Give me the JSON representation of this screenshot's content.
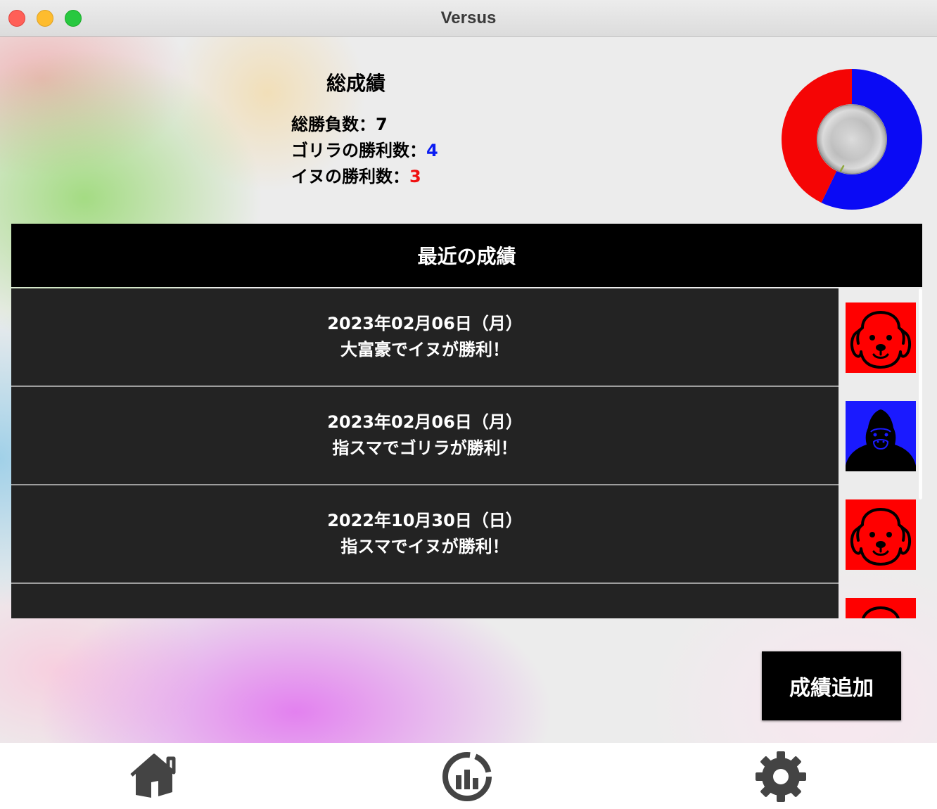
{
  "window": {
    "title": "Versus"
  },
  "summary": {
    "title": "総成績",
    "total_label": "総勝負数：",
    "total_value": "7",
    "gorilla_label": "ゴリラの勝利数：",
    "gorilla_value": "4",
    "dog_label": "イヌの勝利数：",
    "dog_value": "3"
  },
  "donut": {
    "gorilla_wins": 4,
    "dog_wins": 3,
    "gorilla_color": "#0a0af5",
    "dog_color": "#f50505"
  },
  "recent": {
    "header": "最近の成績",
    "rows": [
      {
        "date": "2023年02月06日（月）",
        "result": "大富豪でイヌが勝利！",
        "winner_icon": "dog-icon",
        "color": "#ff0000"
      },
      {
        "date": "2023年02月06日（月）",
        "result": "指スマでゴリラが勝利！",
        "winner_icon": "gorilla-icon",
        "color": "#1a1aff"
      },
      {
        "date": "2022年10月30日（日）",
        "result": "指スマでイヌが勝利！",
        "winner_icon": "dog-icon",
        "color": "#ff0000"
      },
      {
        "date": "",
        "result": "",
        "winner_icon": "dog-icon",
        "color": "#ff0000"
      }
    ]
  },
  "add_button": {
    "label": "成績追加"
  },
  "tabbar": {
    "items": [
      "home-icon",
      "stats-icon",
      "gear-icon"
    ],
    "icon_color": "#444444"
  }
}
